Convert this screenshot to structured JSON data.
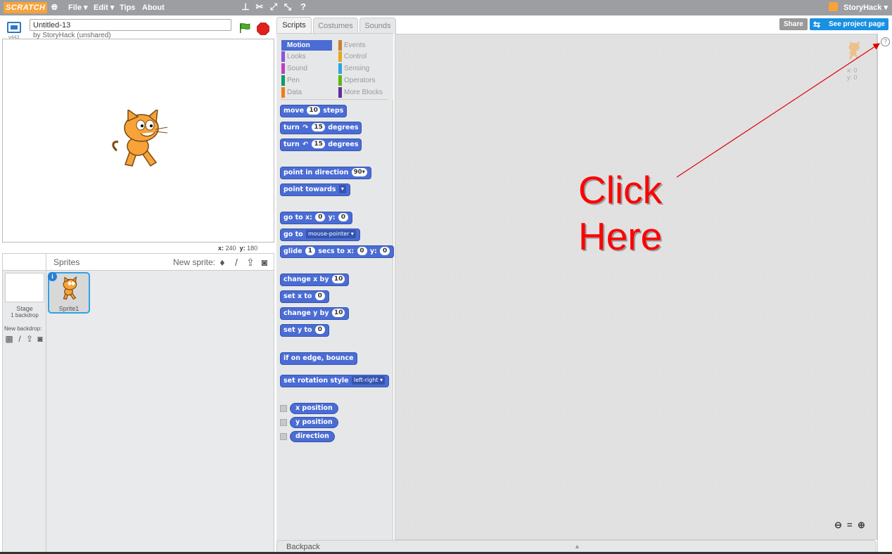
{
  "topbar": {
    "logo": "SCRATCH",
    "menu": [
      "File ▾",
      "Edit ▾",
      "Tips",
      "About"
    ],
    "user": "StoryHack ▾",
    "tools": [
      "duplicate-stamp",
      "delete-cut",
      "grow",
      "shrink",
      "block-help"
    ]
  },
  "stage_header": {
    "version": "v443",
    "project_title": "Untitled-13",
    "byline": "by StoryHack (unshared)"
  },
  "stage": {
    "mouse_x_label": "x:",
    "mouse_x": "240",
    "mouse_y_label": "y:",
    "mouse_y": "180"
  },
  "sprites_pane": {
    "title": "Sprites",
    "new_sprite_label": "New sprite:",
    "stage_label": "Stage",
    "backdrop_count": "1 backdrop",
    "new_backdrop_label": "New backdrop:",
    "sprite1_name": "Sprite1",
    "info_glyph": "i"
  },
  "tabs": [
    "Scripts",
    "Costumes",
    "Sounds"
  ],
  "header_buttons": {
    "share": "Share",
    "see_project": "See project page"
  },
  "categories": [
    {
      "label": "Motion",
      "color": "#4a6cd4"
    },
    {
      "label": "Events",
      "color": "#c88330"
    },
    {
      "label": "Looks",
      "color": "#8a55d7"
    },
    {
      "label": "Control",
      "color": "#e1a91a"
    },
    {
      "label": "Sound",
      "color": "#bb42c3"
    },
    {
      "label": "Sensing",
      "color": "#2ca5e2"
    },
    {
      "label": "Pen",
      "color": "#0e9a6c"
    },
    {
      "label": "Operators",
      "color": "#5cb712"
    },
    {
      "label": "Data",
      "color": "#ee7d16"
    },
    {
      "label": "More Blocks",
      "color": "#632d99"
    }
  ],
  "blocks": {
    "move": {
      "a": "move",
      "v": "10",
      "b": "steps"
    },
    "turn_right": {
      "a": "turn",
      "rot": "↷",
      "v": "15",
      "b": "degrees"
    },
    "turn_left": {
      "a": "turn",
      "rot": "↶",
      "v": "15",
      "b": "degrees"
    },
    "point_direction": {
      "a": "point in direction",
      "v": "90▾"
    },
    "point_towards": {
      "a": "point towards",
      "v": "▾"
    },
    "go_to_xy": {
      "a": "go to x:",
      "x": "0",
      "b": "y:",
      "y": "0"
    },
    "go_to": {
      "a": "go to",
      "v": "mouse-pointer ▾"
    },
    "glide": {
      "a": "glide",
      "v": "1",
      "b": "secs to x:",
      "x": "0",
      "c": "y:",
      "y": "0"
    },
    "change_x": {
      "a": "change x by",
      "v": "10"
    },
    "set_x": {
      "a": "set x to",
      "v": "0"
    },
    "change_y": {
      "a": "change y by",
      "v": "10"
    },
    "set_y": {
      "a": "set y to",
      "v": "0"
    },
    "bounce": {
      "a": "if on edge, bounce"
    },
    "rotation_style": {
      "a": "set rotation style",
      "v": "left-right ▾"
    },
    "x_position": "x position",
    "y_position": "y position",
    "direction": "direction"
  },
  "scripts_area": {
    "sprite_x": "x: 0",
    "sprite_y": "y: 0",
    "zoom_out": "🔍︎−",
    "zoom_reset": "=",
    "zoom_in": "+"
  },
  "help_glyph": "?",
  "backpack": {
    "label": "Backpack",
    "arrow": "▲"
  },
  "annotation": {
    "line1": "Click",
    "line2": "Here",
    "color": "#ff0000"
  }
}
